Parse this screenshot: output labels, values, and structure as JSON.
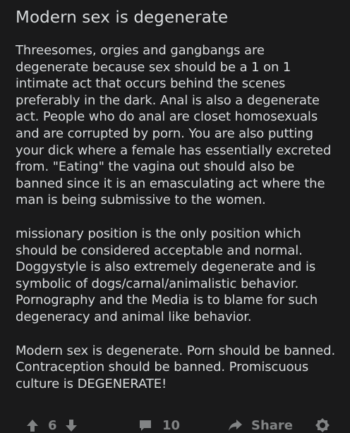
{
  "post": {
    "title": "Modern sex is degenerate",
    "paragraphs": [
      "Threesomes, orgies and gangbangs are degenerate because sex should be a 1 on 1 intimate act that occurs behind the scenes preferably in the dark. Anal is also a degenerate act. People who do anal are closet homosexuals and are corrupted by porn. You are also putting your dick where a female has essentially excreted from. \"Eating\" the vagina out should also be banned since it is an emasculating act where the man is being submissive to the women.",
      "missionary position is the only position which should be considered acceptable and normal. Doggystyle is also extremely degenerate and is symbolic of dogs/carnal/animalistic behavior. Pornography and the Media is to blame for such degeneracy and animal like behavior.",
      "Modern sex is degenerate. Porn should be banned. Contraception should be banned. Promiscuous culture is DEGENERATE!"
    ]
  },
  "actions": {
    "vote_count": "6",
    "comment_count": "10",
    "share_label": "Share",
    "icons": {
      "upvote": "arrow-up-icon",
      "downvote": "arrow-down-icon",
      "comments": "comment-bubble-icon",
      "share": "share-arrow-icon",
      "award": "award-icon"
    }
  },
  "colors": {
    "background": "#1a1a1b",
    "text": "#d7dadc",
    "muted": "#818384"
  }
}
